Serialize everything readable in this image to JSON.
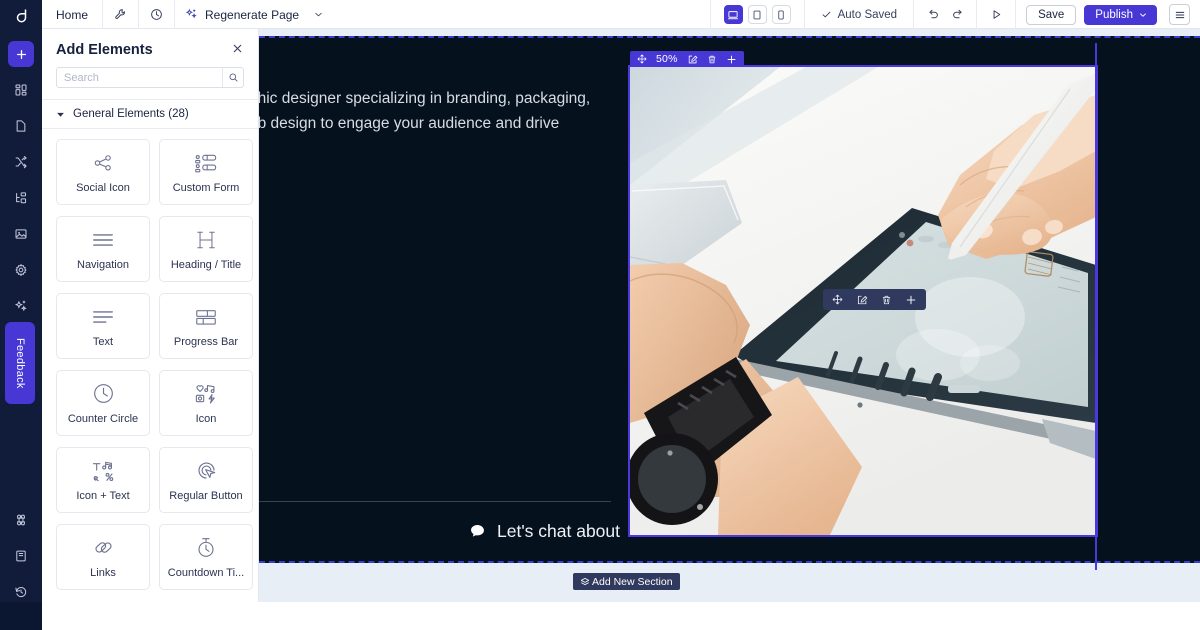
{
  "app": {
    "logo": "logo-mark",
    "accent": "#4737d4",
    "dark_nav": "#111c3a",
    "canvas_bg": "#e8eef5",
    "section_bg": "#05111d"
  },
  "topbar": {
    "home_label": "Home",
    "wrench_icon": "wrench-icon",
    "history_icon": "clock-history-icon",
    "regenerate_label": "Regenerate Page",
    "regenerate_icon": "sparkles-icon",
    "regenerate_caret": "chevron-down-icon",
    "devices": [
      {
        "name": "desktop",
        "icon": "desktop-icon",
        "active": true
      },
      {
        "name": "tablet",
        "icon": "tablet-icon",
        "active": false
      },
      {
        "name": "mobile",
        "icon": "mobile-icon",
        "active": false
      }
    ],
    "autosaved_label": "Auto Saved",
    "autosaved_icon": "check-icon",
    "undo_icon": "undo-icon",
    "redo_icon": "redo-icon",
    "preview_icon": "play-preview-icon",
    "save_label": "Save",
    "publish_label": "Publish",
    "publish_caret": "chevron-down-icon",
    "menu_icon": "hamburger-icon"
  },
  "rail": {
    "items": [
      {
        "name": "add",
        "icon": "plus-icon",
        "active": true
      },
      {
        "name": "sections",
        "icon": "blocks-icon",
        "active": false
      },
      {
        "name": "pages",
        "icon": "page-icon",
        "active": false
      },
      {
        "name": "theme",
        "icon": "shuffle-icon",
        "active": false
      },
      {
        "name": "layers",
        "icon": "layers-tree-icon",
        "active": false
      },
      {
        "name": "media",
        "icon": "image-icon",
        "active": false
      },
      {
        "name": "settings",
        "icon": "gear-icon",
        "active": false
      },
      {
        "name": "ai",
        "icon": "sparkles-icon",
        "active": false
      }
    ],
    "feedback_label": "Feedback",
    "bottom_items": [
      {
        "name": "shortcuts",
        "icon": "command-icon"
      },
      {
        "name": "docs",
        "icon": "book-icon"
      },
      {
        "name": "revisions",
        "icon": "history-revert-icon"
      }
    ]
  },
  "panel": {
    "title": "Add Elements",
    "close_icon": "close-icon",
    "search": {
      "placeholder": "Search",
      "value": "",
      "icon": "search-icon"
    },
    "group": {
      "caret": "caret-down-icon",
      "label": "General Elements (28)"
    },
    "elements": [
      {
        "label": "Social Icon",
        "icon": "share-nodes-icon"
      },
      {
        "label": "Custom Form",
        "icon": "form-rows-icon"
      },
      {
        "label": "Navigation",
        "icon": "nav-lines-icon"
      },
      {
        "label": "Heading / Title",
        "icon": "heading-h-icon"
      },
      {
        "label": "Text",
        "icon": "text-lines-icon"
      },
      {
        "label": "Progress Bar",
        "icon": "progress-bar-icon"
      },
      {
        "label": "Counter Circle",
        "icon": "clock-circle-icon"
      },
      {
        "label": "Icon",
        "icon": "icon-grid-icon"
      },
      {
        "label": "Icon + Text",
        "icon": "icon-text-icon"
      },
      {
        "label": "Regular Button",
        "icon": "cursor-target-icon"
      },
      {
        "label": "Links",
        "icon": "chain-links-icon"
      },
      {
        "label": "Countdown Ti...",
        "icon": "stopwatch-icon"
      }
    ]
  },
  "canvas": {
    "hero_text": "phic designer specializing in branding, packaging,\neb design to engage your audience and drive",
    "chat_label": "Let's chat about",
    "chat_icon": "chat-bubble-icon",
    "image_element": {
      "zoom_label": "50%",
      "move_icon": "move-arrows-icon",
      "edit_icon": "edit-square-icon",
      "delete_icon": "trash-icon",
      "add_icon": "plus-icon",
      "alt": "hands drawing on a tablet with a stylus next to a laptop"
    },
    "float_toolbar": {
      "move_icon": "move-arrows-icon",
      "edit_icon": "edit-square-icon",
      "delete_icon": "trash-icon",
      "add_icon": "plus-icon"
    },
    "add_section_label": "Add New Section",
    "add_section_icon": "layers-add-icon"
  }
}
